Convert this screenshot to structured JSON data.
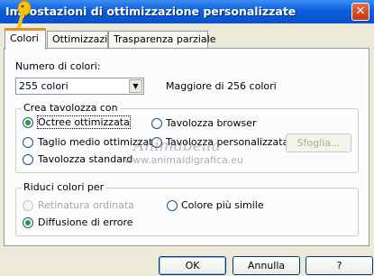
{
  "window": {
    "title": "Impostazioni di ottimizzazione personalizzate",
    "close_glyph": "✕",
    "title_icon": "mascot-icon"
  },
  "tabs": [
    {
      "label": "Colori",
      "active": true
    },
    {
      "label": "Ottimizzazioni",
      "active": false
    },
    {
      "label": "Trasparenza parziale",
      "active": false
    }
  ],
  "colors": {
    "label": "Numero di colori:",
    "selected": "255 colori",
    "note": "Maggiore di 256 colori"
  },
  "palette_group": {
    "title": "Crea tavolozza con",
    "options": {
      "optimized_octree": {
        "label": "Octree ottimizzata",
        "checked": true
      },
      "median_cut": {
        "label": "Taglio medio ottimizzato",
        "checked": false
      },
      "standard": {
        "label": "Tavolozza standard",
        "checked": false
      },
      "browser": {
        "label": "Tavolozza browser",
        "checked": false
      },
      "custom": {
        "label": "Tavolozza personalizzata",
        "checked": false
      }
    },
    "browse_label": "Sfoglia..."
  },
  "reduce_group": {
    "title": "Riduci colori per",
    "options": {
      "ordered_dither": {
        "label": "Retinatura ordinata",
        "disabled": true
      },
      "error_diffusion": {
        "label": "Diffusione di errore",
        "checked": true
      },
      "nearest_color": {
        "label": "Colore più simile",
        "checked": false
      }
    }
  },
  "watermark": {
    "line1": "Animabella",
    "line2": "www.animaidigrafica.eu"
  },
  "buttons": {
    "ok": "OK",
    "cancel": "Annulla",
    "help": "?"
  },
  "colors_theme": {
    "titlebar": "#0a5fdc",
    "dialog_bg": "#ece9d8",
    "panel_bg": "#fcfcfe",
    "radio_check": "#21a121",
    "tab_highlight": "#e68b2c"
  }
}
